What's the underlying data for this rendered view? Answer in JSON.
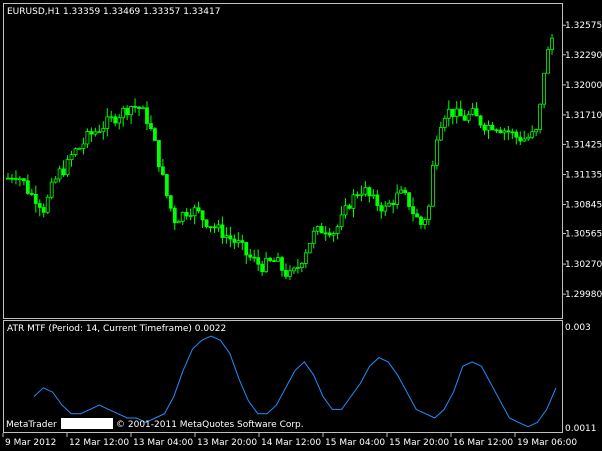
{
  "window": {
    "symbol_header": "EURUSD,H1  1.33359 1.33469 1.33357 1.33417",
    "indicator_header": "ATR MTF (Period: 14, Current Timeframe) 0.0022",
    "copyright_prefix": "MetaTrader",
    "copyright_suffix": "© 2001-2011 MetaQuotes Software Corp."
  },
  "colors": {
    "background": "#000000",
    "frame": "#c0c0c0",
    "candles": "#00ff00",
    "atr_line": "#1e90ff",
    "text": "#ffffff"
  },
  "chart_data": [
    {
      "type": "line",
      "subtype": "candlestick",
      "ylim": [
        1.2975,
        1.3278
      ],
      "yticks": [
        "1.32575",
        "1.32290",
        "1.32000",
        "1.31710",
        "1.31425",
        "1.31135",
        "1.30845",
        "1.30565",
        "1.30270",
        "1.29980"
      ],
      "x": [
        "9 Mar 2012",
        "12 Mar 12:00",
        "13 Mar 04:00",
        "13 Mar 20:00",
        "14 Mar 12:00",
        "15 Mar 04:00",
        "15 Mar 20:00",
        "16 Mar 12:00",
        "19 Mar 06:00"
      ],
      "approx_close_path": [
        1.311,
        1.3115,
        1.3108,
        1.3095,
        1.309,
        1.308,
        1.31,
        1.3115,
        1.312,
        1.3135,
        1.314,
        1.315,
        1.3155,
        1.316,
        1.3165,
        1.317,
        1.3175,
        1.318,
        1.3178,
        1.317,
        1.315,
        1.312,
        1.309,
        1.307,
        1.3075,
        1.308,
        1.3078,
        1.307,
        1.3065,
        1.306,
        1.3055,
        1.305,
        1.3045,
        1.3035,
        1.303,
        1.3025,
        1.3028,
        1.303,
        1.302,
        1.3015,
        1.3025,
        1.304,
        1.3055,
        1.306,
        1.3062,
        1.3058,
        1.307,
        1.3085,
        1.3095,
        1.31,
        1.309,
        1.3085,
        1.308,
        1.3088,
        1.3095,
        1.309,
        1.3075,
        1.3065,
        1.308,
        1.315,
        1.3172,
        1.3175,
        1.317,
        1.3168,
        1.3172,
        1.3165,
        1.316,
        1.3162,
        1.3158,
        1.3155,
        1.315,
        1.3148,
        1.315,
        1.3155,
        1.322,
        1.3245
      ]
    },
    {
      "type": "line",
      "title": "ATR MTF (Period: 14, Current Timeframe) 0.0022",
      "ylim": [
        0.0009,
        0.0031
      ],
      "yticks": [
        "0.003",
        "0.0011"
      ],
      "values": [
        0.0017,
        0.0019,
        0.0018,
        0.0015,
        0.0013,
        0.0013,
        0.0014,
        0.0015,
        0.0014,
        0.0013,
        0.0012,
        0.0012,
        0.0011,
        0.0012,
        0.0013,
        0.0017,
        0.0023,
        0.0028,
        0.003,
        0.0031,
        0.003,
        0.0027,
        0.0021,
        0.0016,
        0.0013,
        0.0013,
        0.0015,
        0.0019,
        0.0023,
        0.0025,
        0.0022,
        0.0017,
        0.0014,
        0.0014,
        0.0017,
        0.002,
        0.0024,
        0.0026,
        0.0025,
        0.0022,
        0.0018,
        0.0014,
        0.0013,
        0.0012,
        0.0014,
        0.0018,
        0.0024,
        0.0025,
        0.0024,
        0.002,
        0.0016,
        0.0012,
        0.0011,
        0.001,
        0.0011,
        0.0014,
        0.0019
      ]
    }
  ]
}
